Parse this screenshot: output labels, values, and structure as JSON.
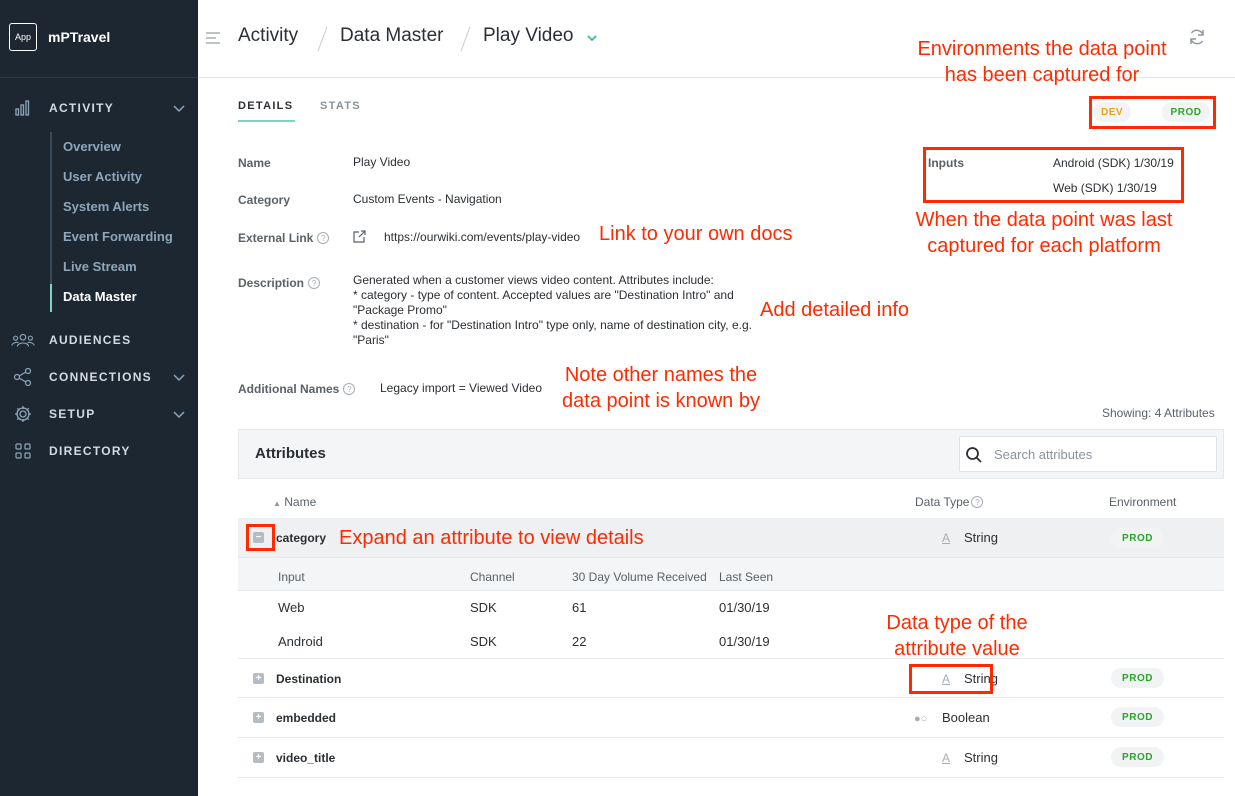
{
  "app": {
    "logo_text": "App",
    "name": "mPTravel"
  },
  "sidebar": {
    "sections": [
      {
        "label": "ACTIVITY",
        "icon": "bar-chart-icon",
        "chevron": true
      },
      {
        "label": "AUDIENCES",
        "icon": "users-icon",
        "chevron": false
      },
      {
        "label": "CONNECTIONS",
        "icon": "connections-icon",
        "chevron": true
      },
      {
        "label": "SETUP",
        "icon": "gear-icon",
        "chevron": true
      },
      {
        "label": "DIRECTORY",
        "icon": "grid-icon",
        "chevron": false
      }
    ],
    "activity_items": [
      "Overview",
      "User Activity",
      "System Alerts",
      "Event Forwarding",
      "Live Stream",
      "Data Master"
    ],
    "active_item": "Data Master"
  },
  "breadcrumb": {
    "items": [
      "Activity",
      "Data Master",
      "Play Video"
    ]
  },
  "tabs": [
    {
      "label": "DETAILS",
      "active": true
    },
    {
      "label": "STATS",
      "active": false
    }
  ],
  "environments": [
    {
      "label": "DEV",
      "color": "#e8a317"
    },
    {
      "label": "PROD",
      "color": "#2aa52a"
    }
  ],
  "details": {
    "name_label": "Name",
    "name": "Play Video",
    "category_label": "Category",
    "category": "Custom Events - Navigation",
    "link_label": "External Link",
    "link": "https://ourwiki.com/events/play-video",
    "description_label": "Description",
    "description_lines": [
      "Generated when a customer views video content. Attributes include:",
      "* category - type of content. Accepted values are \"Destination Intro\" and",
      "\"Package Promo\"",
      "* destination - for \"Destination Intro\" type only, name of destination city, e.g.",
      "\"Paris\""
    ],
    "additional_names_label": "Additional Names",
    "additional_names": "Legacy import = Viewed Video",
    "inputs_label": "Inputs",
    "inputs": [
      {
        "platform": "Android (SDK)",
        "date": "1/30/19"
      },
      {
        "platform": "Web (SDK)",
        "date": "1/30/19"
      }
    ]
  },
  "annotations": {
    "environments": [
      "Environments the data point",
      "has been captured for"
    ],
    "last_captured": [
      "When the data point was last",
      "captured for each platform"
    ],
    "link": "Link to your own docs",
    "detailed": "Add detailed info",
    "other_names": [
      "Note other names the",
      "data point is known by"
    ],
    "expand": "Expand an attribute to view details",
    "data_type": [
      "Data type of the",
      "attribute value"
    ]
  },
  "attributes": {
    "showing": "Showing: 4 Attributes",
    "title": "Attributes",
    "search_placeholder": "Search attributes",
    "columns": {
      "name": "Name",
      "data_type": "Data Type",
      "environment": "Environment"
    },
    "rows": [
      {
        "name": "category",
        "data_type": "String",
        "env": "PROD",
        "expanded": true
      },
      {
        "name": "Destination",
        "data_type": "String",
        "env": "PROD"
      },
      {
        "name": "embedded",
        "data_type": "Boolean",
        "env": "PROD"
      },
      {
        "name": "video_title",
        "data_type": "String",
        "env": "PROD"
      }
    ],
    "detail_columns": [
      "Input",
      "Channel",
      "30 Day Volume Received",
      "Last Seen"
    ],
    "detail_rows": [
      {
        "input": "Web",
        "channel": "SDK",
        "volume": "61",
        "last_seen": "01/30/19"
      },
      {
        "input": "Android",
        "channel": "SDK",
        "volume": "22",
        "last_seen": "01/30/19"
      }
    ]
  }
}
